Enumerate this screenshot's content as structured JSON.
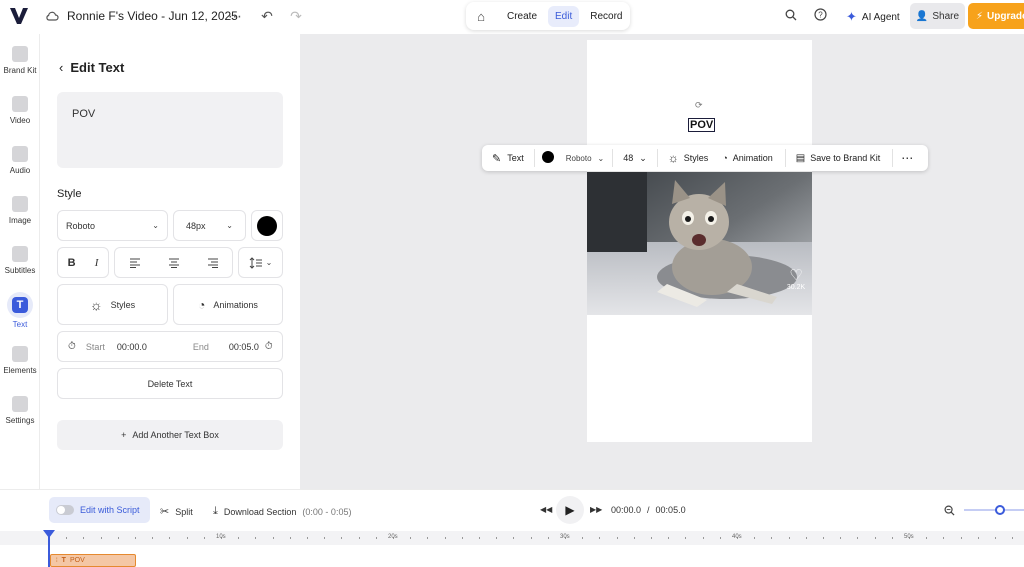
{
  "topbar": {
    "project_title": "Ronnie F's Video - Jun 12, 2025",
    "tabs": [
      "Create",
      "Edit",
      "Record"
    ],
    "active_tab": "Edit",
    "ai_agent_label": "AI Agent",
    "share_label": "Share",
    "upgrade_label": "Upgrade"
  },
  "rail": {
    "items": [
      {
        "label": "Brand Kit",
        "icon": "brand-kit-icon"
      },
      {
        "label": "Video",
        "icon": "video-icon"
      },
      {
        "label": "Audio",
        "icon": "audio-icon"
      },
      {
        "label": "Image",
        "icon": "image-icon"
      },
      {
        "label": "Subtitles",
        "icon": "subtitles-icon"
      },
      {
        "label": "Text",
        "icon": "text-icon",
        "glyph": "T"
      },
      {
        "label": "Elements",
        "icon": "elements-icon"
      },
      {
        "label": "Settings",
        "icon": "settings-icon"
      }
    ],
    "active": "Text"
  },
  "panel": {
    "heading": "Edit Text",
    "text_value": "POV",
    "style_heading": "Style",
    "font": "Roboto",
    "font_size": "48px",
    "color": "#000000",
    "bold_glyph": "B",
    "italic_glyph": "I",
    "styles_label": "Styles",
    "animations_label": "Animations",
    "start_label": "Start",
    "start_value": "00:00.0",
    "end_label": "End",
    "end_value": "00:05.0",
    "delete_label": "Delete Text",
    "add_label": "Add Another Text Box"
  },
  "canvas": {
    "caption": "POV",
    "toolbar": {
      "text_label": "Text",
      "font": "Roboto",
      "size": "48",
      "styles_label": "Styles",
      "animation_label": "Animation",
      "save_label": "Save to Brand Kit"
    },
    "like_count": "30.2K"
  },
  "bottom": {
    "script_label": "Edit with Script",
    "split_label": "Split",
    "download_label": "Download Section",
    "download_range": "(0:00 - 0:05)",
    "current_time": "00:00.0",
    "separator": "/",
    "total_time": "00:05.0"
  },
  "timeline": {
    "ruler_labels": [
      "10s",
      "20s",
      "30s",
      "40s",
      "50s"
    ],
    "clip_label": "POV"
  },
  "colors": {
    "accent": "#3b5bdb",
    "upgrade": "#f7a21b",
    "clip": "#f4c7a5"
  }
}
